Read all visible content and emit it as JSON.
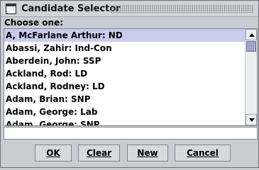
{
  "window": {
    "title": "Candidate Selector"
  },
  "prompt": "Choose one:",
  "list": {
    "items": [
      "A, McFarlane Arthur: ND",
      "Abassi, Zahir: Ind-Con",
      "Aberdein, John: SSP",
      "Ackland, Rod: LD",
      "Ackland, Rodney: LD",
      "Adam, Brian: SNP",
      "Adam, George: Lab",
      "Adam, George: SNP"
    ],
    "selected_index": 0
  },
  "buttons": {
    "ok": "OK",
    "clear": "Clear",
    "new": "New",
    "cancel": "Cancel"
  },
  "colors": {
    "selection": "#c8cdee",
    "thumb": "#8d92b7"
  }
}
